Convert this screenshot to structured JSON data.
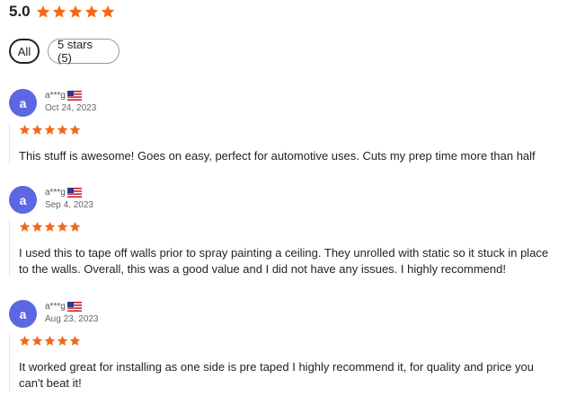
{
  "summary": {
    "score": "5.0",
    "stars": 5
  },
  "filters": [
    {
      "label": "All",
      "active": true
    },
    {
      "label": "5 stars (5)",
      "active": false
    }
  ],
  "reviews": [
    {
      "avatar": "a",
      "username": "a***g",
      "date": "Oct 24, 2023",
      "rating": 5,
      "text": "This stuff is awesome! Goes on easy, perfect for automotive uses. Cuts my prep time more than half"
    },
    {
      "avatar": "a",
      "username": "a***g",
      "date": "Sep 4, 2023",
      "rating": 5,
      "text": "I used this to tape off walls prior to spray painting a ceiling. They unrolled with static so it stuck in place to the walls. Overall, this was a good value and I did not have any issues. I highly recommend!"
    },
    {
      "avatar": "a",
      "username": "a***g",
      "date": "Aug 23, 2023",
      "rating": 5,
      "text": "It worked great for installing as one side is pre taped I highly recommend it, for quality and price you can't beat it!"
    }
  ],
  "colors": {
    "star": "#f06a1b",
    "avatar": "#5b67e3"
  },
  "icons": {
    "star": "star-icon",
    "flag": "us-flag-icon"
  }
}
